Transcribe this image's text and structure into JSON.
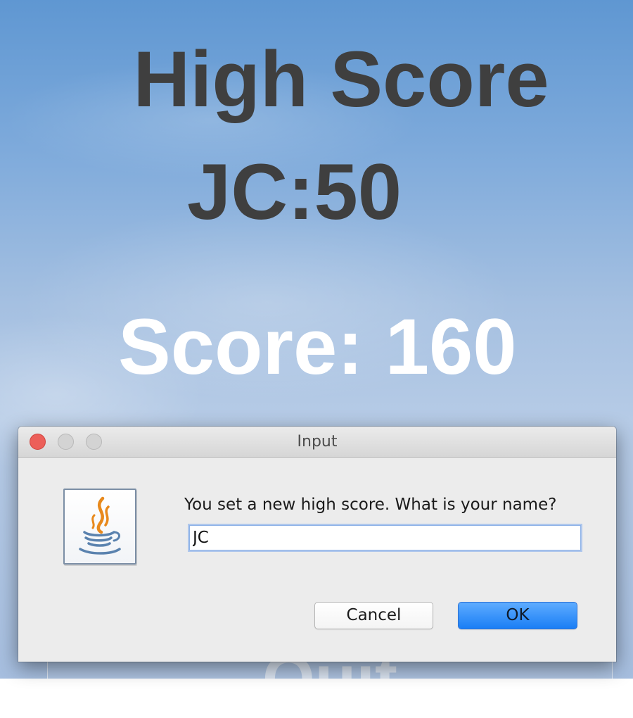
{
  "game": {
    "high_score_title": "High Score",
    "high_score_entry": "JC:50",
    "score_text": "Score: 160",
    "quit_label": "Quit"
  },
  "dialog": {
    "title": "Input",
    "window_controls": [
      "close",
      "minimize",
      "maximize"
    ],
    "icon": "java-cup-icon",
    "prompt": "You set a new high score. What is your name?",
    "input_value": "JC",
    "buttons": {
      "cancel": "Cancel",
      "ok": "OK"
    }
  },
  "colors": {
    "background_top": "#5f97d2",
    "background_bottom": "#a6bedf",
    "high_score_text": "#3f3f3f",
    "score_text": "#ffffff",
    "dialog_bg": "#ececec",
    "ok_button": "#1a7ef5",
    "close_button": "#ec5f59"
  }
}
